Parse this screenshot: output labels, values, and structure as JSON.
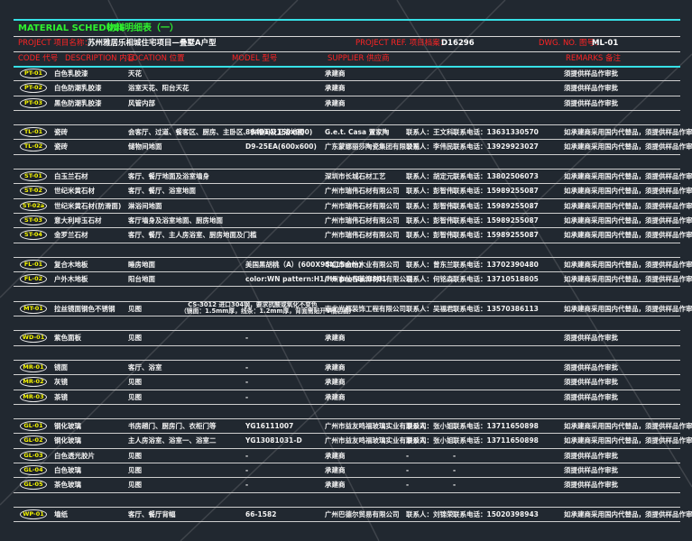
{
  "header": {
    "title_en": "MATERIAL SCHEDULE",
    "title_cn": "物料明细表（一）",
    "project_label": "PROJECT 项目名称：",
    "project_value": "苏州雅居乐相城住宅项目—叠墅A户型",
    "ref_label": "PROJECT REF. 项目档案：",
    "ref_value": "D16296",
    "dwg_label": "DWG. NO. 图号：",
    "dwg_value": "ML-01"
  },
  "columns": {
    "code": "CODE 代号",
    "description": "DESCRIPTION 内容",
    "location": "LOCATION 位置",
    "model": "MODEL 型号",
    "supplier": "SUPPLIER 供应商",
    "remarks": "REMARKS 备注"
  },
  "rows": [
    {
      "code": "PT-01",
      "desc": "白色乳胶漆",
      "loc": "天花",
      "model": "",
      "supplier": "承建商",
      "contact": "",
      "phone": "",
      "remark": "须提供样品作审批"
    },
    {
      "code": "PT-02",
      "desc": "白色防潮乳胶漆",
      "loc": "浴室天花、阳台天花",
      "model": "",
      "supplier": "承建商",
      "contact": "",
      "phone": "",
      "remark": "须提供样品作审批"
    },
    {
      "code": "PT-03",
      "desc": "黑色防潮乳胶漆",
      "loc": "风管内部",
      "model": "",
      "supplier": "承建商",
      "contact": "",
      "phone": "",
      "remark": "须提供样品作审批"
    },
    {
      "gap": true
    },
    {
      "code": "TL-01",
      "desc": "瓷砖",
      "loc": "会客厅、过道、餐客区、厨房、主卧区、衣帽间及卫浴地面",
      "model": "894014(150x900)",
      "supplier": "G.e.t. Casa 置家陶",
      "contact": "联系人：王文科",
      "phone": "联系电话：13631330570",
      "remark": "如承建商采用国内代替品，须提供样品作审批"
    },
    {
      "code": "TL-02",
      "desc": "瓷砖",
      "loc": "储物间地面",
      "model": "D9-25EA(600x600)",
      "supplier": "广东蒙娜丽莎陶瓷集团有限公司",
      "contact": "联系人：李伟民",
      "phone": "联系电话：13929923027",
      "remark": "如承建商采用国内代替品，须提供样品作审批"
    },
    {
      "gap": true
    },
    {
      "code": "ST-01",
      "desc": "白玉兰石材",
      "loc": "客厅、餐厅地面及浴室墙身",
      "model": "",
      "supplier": "深圳市长城石材工艺",
      "contact": "联系人：胡定元",
      "phone": "联系电话：13802506073",
      "remark": "如承建商采用国内代替品，须提供样品作审批"
    },
    {
      "code": "ST-02",
      "desc": "世纪米黄石材",
      "loc": "客厅、餐厅、浴室地面",
      "model": "",
      "supplier": "广州市瑞伟石材有限公司",
      "contact": "联系人：彭智伟",
      "phone": "联系电话：15989255087",
      "remark": "如承建商采用国内代替品，须提供样品作审批"
    },
    {
      "code": "ST-02a",
      "desc": "世纪米黄石材(防滑面)",
      "loc": "淋浴间地面",
      "model": "",
      "supplier": "广州市瑞伟石材有限公司",
      "contact": "联系人：彭智伟",
      "phone": "联系电话：15989255087",
      "remark": "如承建商采用国内代替品，须提供样品作审批"
    },
    {
      "code": "ST-03",
      "desc": "意大利啡玉石材",
      "loc": "客厅墙身及浴室地面、厨房地面",
      "model": "",
      "supplier": "广州市瑞伟石材有限公司",
      "contact": "联系人：彭智伟",
      "phone": "联系电话：15989255087",
      "remark": "如承建商采用国内代替品，须提供样品作审批"
    },
    {
      "code": "ST-04",
      "desc": "金罗兰石材",
      "loc": "客厅、餐厅、主人房浴室、厨房地面及门槛",
      "model": "",
      "supplier": "广州市瑞伟石材有限公司",
      "contact": "联系人：彭智伟",
      "phone": "联系电话：15989255087",
      "remark": "如承建商采用国内代替品，须提供样品作审批"
    },
    {
      "gap": true
    },
    {
      "code": "FL-01",
      "desc": "复合木地板",
      "loc": "睡房地面",
      "model": "美国黑胡桃（A）(600X95X15mm)",
      "supplier": "中山市金怡木业有限公司",
      "contact": "联系人：曾东兰",
      "phone": "联系电话：13702390480",
      "remark": "如承建商采用国内代替品，须提供样品作审批"
    },
    {
      "code": "FL-02",
      "desc": "户外木地板",
      "loc": "阳台地面",
      "model": "color:WN   pattern:H1/H6   profile:US01",
      "supplier": "广州市仙谷装饰材料有限公司",
      "contact": "联系人：何铭森",
      "phone": "联系电话：13710518805",
      "remark": "如承建商采用国内代替品，须提供样品作审批"
    },
    {
      "gap": true
    },
    {
      "code": "MT-01",
      "desc": "拉丝镜面钢色不锈钢",
      "loc": "见图",
      "model": "CS-3012 进口304钢，要求抗酸或氧化不变色",
      "model2": "（镜面：1.5mm厚，线条：1.2mm厚，背面需贴开V槽后面）",
      "supplier": "南北光都装饰工程有限公司",
      "contact": "联系人：吴福君",
      "phone": "联系电话：13570386113",
      "remark": "如承建商采用国内代替品，须提供样品作审批"
    },
    {
      "gap": true
    },
    {
      "code": "WD-01",
      "desc": "紫色面板",
      "loc": "见图",
      "model": "-",
      "supplier": "承建商",
      "contact": "",
      "phone": "",
      "remark": "须提供样品作审批"
    },
    {
      "gap": true
    },
    {
      "code": "MR-01",
      "desc": "镜面",
      "loc": "客厅、浴室",
      "model": "-",
      "supplier": "承建商",
      "contact": "",
      "phone": "",
      "remark": "须提供样品作审批"
    },
    {
      "code": "MR-02",
      "desc": "灰镜",
      "loc": "见图",
      "model": "-",
      "supplier": "承建商",
      "contact": "",
      "phone": "",
      "remark": "须提供样品作审批"
    },
    {
      "code": "MR-03",
      "desc": "茶镜",
      "loc": "见图",
      "model": "-",
      "supplier": "承建商",
      "contact": "",
      "phone": "",
      "remark": "须提供样品作审批"
    },
    {
      "gap": true
    },
    {
      "code": "GL-01",
      "desc": "钢化玻璃",
      "loc": "书房趟门、厨房门、衣柜门等",
      "model": "YG16111007",
      "supplier": "广州市益友鸣福玻璃实业有限公司",
      "contact": "联系人：张小姐",
      "phone": "联系电话：13711650898",
      "remark": "如承建商采用国内代替品，须提供样品作审批"
    },
    {
      "code": "GL-02",
      "desc": "钢化玻璃",
      "loc": "主人房浴室、浴室一、浴室二",
      "model": "YG13081031-D",
      "supplier": "广州市益友鸣福玻璃实业有限公司",
      "contact": "联系人：张小姐",
      "phone": "联系电话：13711650898",
      "remark": "如承建商采用国内代替品，须提供样品作审批"
    },
    {
      "code": "GL-03",
      "desc": "白色透光胶片",
      "loc": "见图",
      "model": "-",
      "supplier": "承建商",
      "contact": "-",
      "phone": "-",
      "remark": "须提供样品作审批"
    },
    {
      "code": "GL-04",
      "desc": "白色玻璃",
      "loc": "见图",
      "model": "-",
      "supplier": "承建商",
      "contact": "-",
      "phone": "-",
      "remark": "须提供样品作审批"
    },
    {
      "code": "GL-05",
      "desc": "茶色玻璃",
      "loc": "见图",
      "model": "-",
      "supplier": "承建商",
      "contact": "-",
      "phone": "-",
      "remark": "须提供样品作审批"
    },
    {
      "gap": true
    },
    {
      "code": "WP-01",
      "desc": "墙纸",
      "loc": "客厅、餐厅背幅",
      "model": "66-1582",
      "supplier": "广州巴德尔贸易有限公司",
      "contact": "联系人：刘锦荣",
      "phone": "联系电话：15020398943",
      "remark": "如承建商采用国内代替品，须提供样品作审批"
    }
  ],
  "colors": {
    "title": "#2ef02e",
    "header": "#ff2424",
    "code": "#f4f400",
    "rule": "#37e0e6",
    "background": "#212830"
  }
}
